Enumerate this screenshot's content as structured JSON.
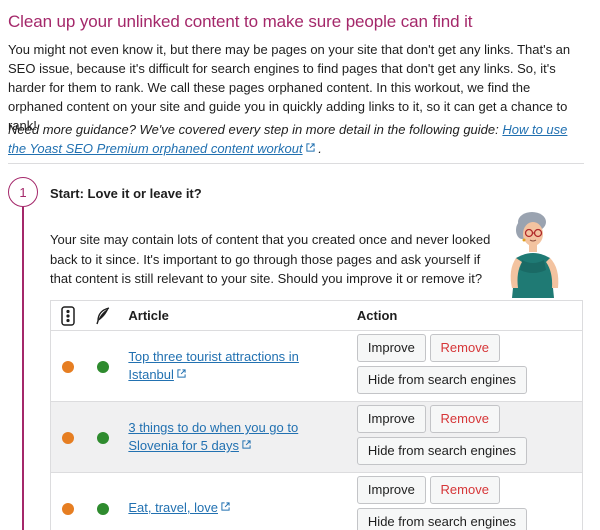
{
  "page": {
    "title": "Clean up your unlinked content to make sure people can find it",
    "intro": "You might not even know it, but there may be pages on your site that don't get any links. That's an SEO issue, because it's difficult for search engines to find pages that don't get any links. So, it's harder for them to rank. We call these pages orphaned content. In this workout, we find the orphaned content on your site and guide you in quickly adding links to it, so it can get a chance to rank!",
    "guidance_prefix": "Need more guidance? We've covered every step in more detail in the following guide: ",
    "guidance_link": "How to use the Yoast SEO Premium orphaned content workout",
    "guidance_suffix": " ."
  },
  "step": {
    "number": "1",
    "title": "Start: Love it or leave it?",
    "description": "Your site may contain lots of content that you created once and never looked back to it since. It's important to go through those pages and ask yourself if that content is still relevant to your site. Should you improve it or remove it?"
  },
  "table": {
    "headers": {
      "seo_icon": "traffic-light-icon",
      "readability_icon": "feather-icon",
      "article": "Article",
      "action": "Action"
    },
    "rows": [
      {
        "seo_color": "#e67e22",
        "readability_color": "#2e8b2e",
        "article": "Top three tourist attractions in Istanbul"
      },
      {
        "seo_color": "#e67e22",
        "readability_color": "#2e8b2e",
        "article": "3 things to do when you go to Slovenia for 5 days"
      },
      {
        "seo_color": "#e67e22",
        "readability_color": "#2e8b2e",
        "article": "Eat, travel, love"
      }
    ],
    "buttons": {
      "improve": "Improve",
      "remove": "Remove",
      "hide": "Hide from search engines"
    }
  },
  "colors": {
    "brand": "#a4286a",
    "link": "#2271b1",
    "remove": "#d63638",
    "seo_dot": "#e67e22",
    "readability_dot": "#2e8b2e"
  }
}
